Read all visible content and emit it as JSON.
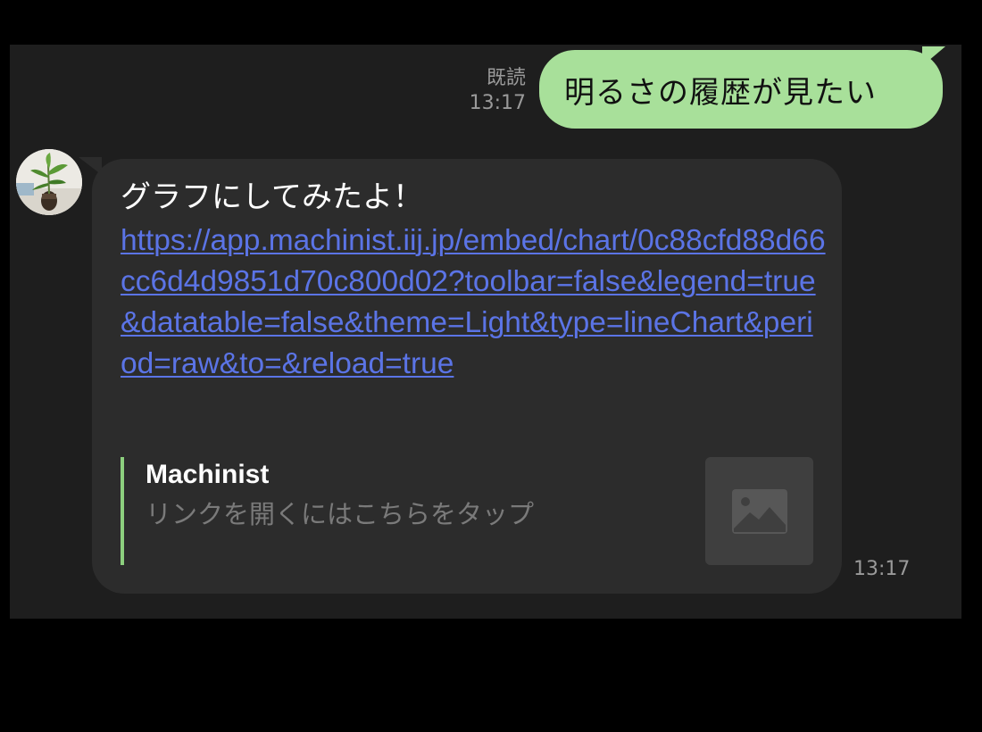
{
  "chat": {
    "outgoing": {
      "read_label": "既読",
      "time": "13:17",
      "text": "明るさの履歴が見たい",
      "bubble_color": "#a8e09a"
    },
    "incoming": {
      "avatar_icon": "plant-avatar",
      "text": "グラフにしてみたよ！",
      "link": "https://app.machinist.iij.jp/embed/chart/0c88cfd88d66cc6d4d9851d70c800d02?toolbar=false&legend=true&datatable=false&theme=Light&type=lineChart&period=raw&to=&reload=true",
      "link_color": "#5b74e6",
      "time": "13:17",
      "preview": {
        "title": "Machinist",
        "description": "リンクを開くにはこちらをタップ",
        "thumbnail_icon": "image-placeholder-icon",
        "accent_color": "#8ccf7e"
      }
    }
  }
}
